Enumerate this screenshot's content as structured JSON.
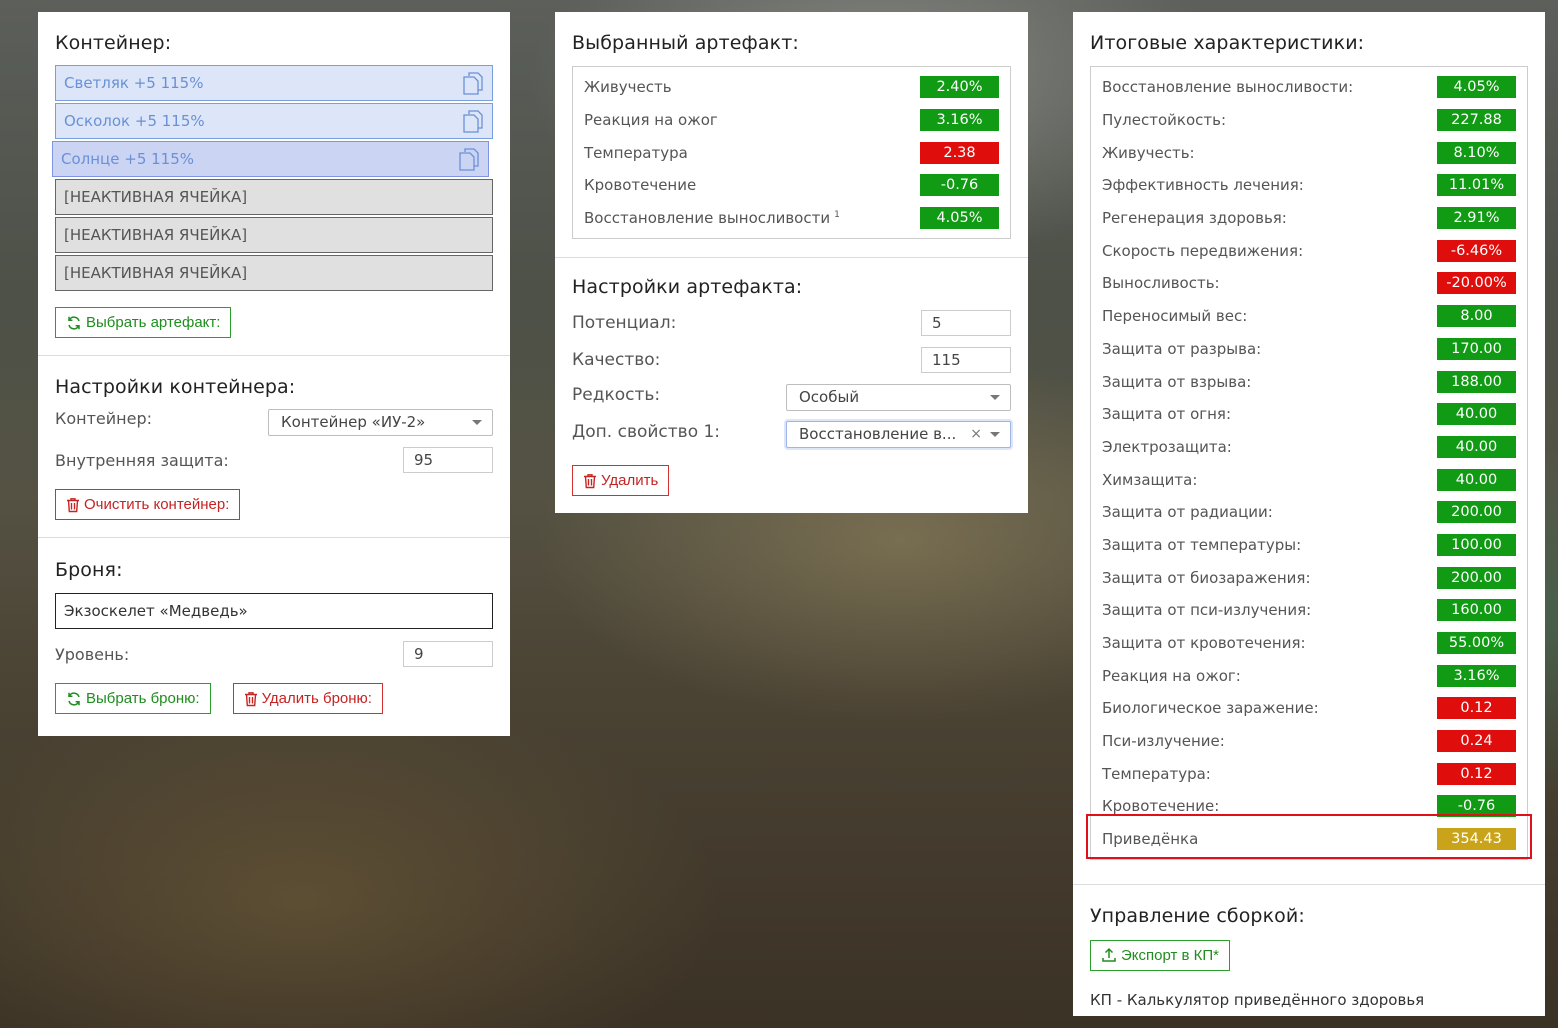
{
  "container_panel": {
    "title": "Контейнер:",
    "slots": [
      {
        "label": "Светляк +5 115%",
        "state": "filled"
      },
      {
        "label": "Осколок +5 115%",
        "state": "filled"
      },
      {
        "label": "Солнце +5 115%",
        "state": "selected"
      },
      {
        "label": "[НЕАКТИВНАЯ ЯЧЕЙКА]",
        "state": "inactive"
      },
      {
        "label": "[НЕАКТИВНАЯ ЯЧЕЙКА]",
        "state": "inactive"
      },
      {
        "label": "[НЕАКТИВНАЯ ЯЧЕЙКА]",
        "state": "inactive"
      }
    ],
    "choose_artifact_button": "Выбрать артефакт:",
    "settings": {
      "title": "Настройки контейнера:",
      "container_label": "Контейнер:",
      "container_value": "Контейнер «ИУ-2»",
      "internal_protection_label": "Внутренняя защита:",
      "internal_protection_value": "95",
      "clear_button": "Очистить контейнер:"
    },
    "armor": {
      "title": "Броня:",
      "armor_value": "Экзоскелет «Медведь»",
      "level_label": "Уровень:",
      "level_value": "9",
      "choose_button": "Выбрать броню:",
      "delete_button": "Удалить броню:"
    }
  },
  "artifact_panel": {
    "title": "Выбранный артефакт:",
    "stats": [
      {
        "name": "Живучесть",
        "value": "2.40%",
        "status": "positive"
      },
      {
        "name": "Реакция на ожог",
        "value": "3.16%",
        "status": "positive"
      },
      {
        "name": "Температура",
        "value": "2.38",
        "status": "negative"
      },
      {
        "name": "Кровотечение",
        "value": "-0.76",
        "status": "positive"
      },
      {
        "name": "Восстановление выносливости",
        "value": "4.05%",
        "status": "positive",
        "footnote": "1"
      }
    ],
    "settings": {
      "title": "Настройки артефакта:",
      "potential_label": "Потенциал:",
      "potential_value": "5",
      "quality_label": "Качество:",
      "quality_value": "115",
      "rarity_label": "Редкость:",
      "rarity_value": "Особый",
      "extra_prop_label": "Доп. свойство 1:",
      "extra_prop_value": "Восстановление в...",
      "extra_prop_clear": "×",
      "delete_button": "Удалить"
    }
  },
  "totals_panel": {
    "title": "Итоговые характеристики:",
    "stats": [
      {
        "name": "Восстановление выносливости:",
        "value": "4.05%",
        "status": "positive"
      },
      {
        "name": "Пулестойкость:",
        "value": "227.88",
        "status": "positive"
      },
      {
        "name": "Живучесть:",
        "value": "8.10%",
        "status": "positive"
      },
      {
        "name": "Эффективность лечения:",
        "value": "11.01%",
        "status": "positive"
      },
      {
        "name": "Регенерация здоровья:",
        "value": "2.91%",
        "status": "positive"
      },
      {
        "name": "Скорость передвижения:",
        "value": "-6.46%",
        "status": "negative"
      },
      {
        "name": "Выносливость:",
        "value": "-20.00%",
        "status": "negative"
      },
      {
        "name": "Переносимый вес:",
        "value": "8.00",
        "status": "positive"
      },
      {
        "name": "Защита от разрыва:",
        "value": "170.00",
        "status": "positive"
      },
      {
        "name": "Защита от взрыва:",
        "value": "188.00",
        "status": "positive"
      },
      {
        "name": "Защита от огня:",
        "value": "40.00",
        "status": "positive"
      },
      {
        "name": "Электрозащита:",
        "value": "40.00",
        "status": "positive"
      },
      {
        "name": "Химзащита:",
        "value": "40.00",
        "status": "positive"
      },
      {
        "name": "Защита от радиации:",
        "value": "200.00",
        "status": "positive"
      },
      {
        "name": "Защита от температуры:",
        "value": "100.00",
        "status": "positive"
      },
      {
        "name": "Защита от биозаражения:",
        "value": "200.00",
        "status": "positive"
      },
      {
        "name": "Защита от пси-излучения:",
        "value": "160.00",
        "status": "positive"
      },
      {
        "name": "Защита от кровотечения:",
        "value": "55.00%",
        "status": "positive"
      },
      {
        "name": "Реакция на ожог:",
        "value": "3.16%",
        "status": "positive"
      },
      {
        "name": "Биологическое заражение:",
        "value": "0.12",
        "status": "negative"
      },
      {
        "name": "Пси-излучение:",
        "value": "0.24",
        "status": "negative"
      },
      {
        "name": "Температура:",
        "value": "0.12",
        "status": "negative"
      },
      {
        "name": "Кровотечение:",
        "value": "-0.76",
        "status": "positive"
      },
      {
        "name": "Приведёнка",
        "value": "354.43",
        "status": "summary"
      }
    ],
    "build_management": {
      "title": "Управление сборкой:",
      "export_button": "Экспорт в КП*",
      "footnote": "КП - Калькулятор приведённого здоровья"
    }
  },
  "colors": {
    "positive": "#119a13",
    "negative": "#e00d0d",
    "summary": "#c9a41a",
    "slot_blue": "#dde6f8",
    "highlight_border": "#e0101a"
  }
}
